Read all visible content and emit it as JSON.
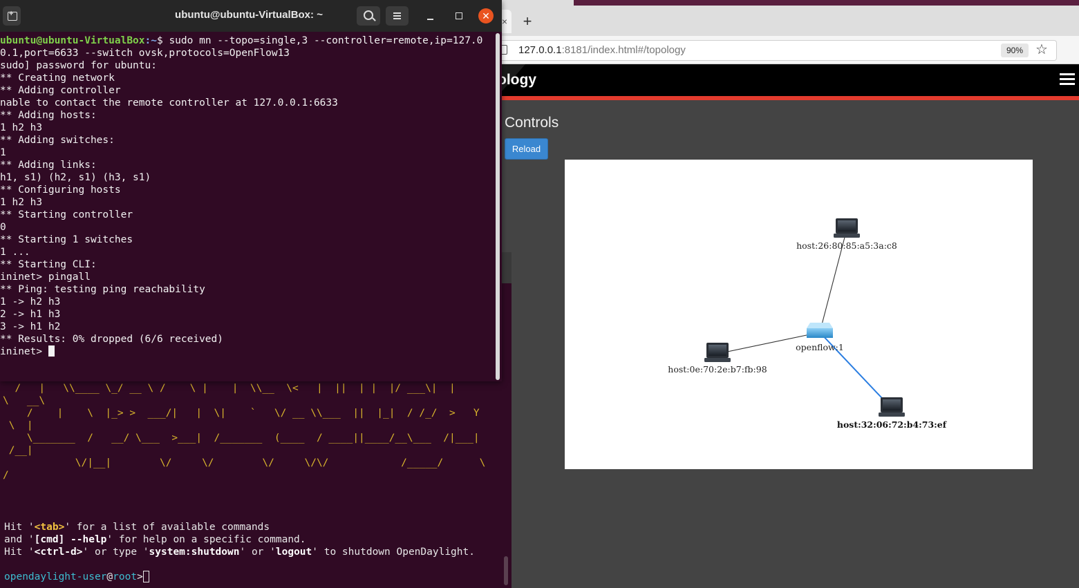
{
  "browser": {
    "url_host": "127.0.0.1",
    "url_rest": ":8181/index.html#/topology",
    "zoom": "90%",
    "tab_close_glyph": "×",
    "new_tab_glyph": "+",
    "page_title": "ology",
    "controls_heading": "Controls",
    "reload_label": "Reload"
  },
  "topology": {
    "nodes": [
      {
        "id": "host-top",
        "label": "host:26:80:85:a5:3a:c8",
        "type": "host",
        "bold": false
      },
      {
        "id": "switch",
        "label": "openflow:1",
        "type": "switch",
        "bold": false
      },
      {
        "id": "host-left",
        "label": "host:0e:70:2e:b7:fb:98",
        "type": "host",
        "bold": false
      },
      {
        "id": "host-bottom",
        "label": "host:32:06:72:b4:73:ef",
        "type": "host",
        "bold": true
      }
    ],
    "links": [
      {
        "from": "switch",
        "to": "host-top",
        "color": "#333333"
      },
      {
        "from": "switch",
        "to": "host-left",
        "color": "#333333"
      },
      {
        "from": "switch",
        "to": "host-bottom",
        "color": "#2a7de1"
      }
    ]
  },
  "mininet_terminal": {
    "title": "ubuntu@ubuntu-VirtualBox: ~",
    "prompt_user": "ubuntu@ubuntu-VirtualBox",
    "prompt_path": ":~",
    "command": "$ sudo mn --topo=single,3 --controller=remote,ip=127.0\n0.1,port=6633 --switch ovsk,protocols=OpenFlow13",
    "output": "sudo] password for ubuntu:\n** Creating network\n** Adding controller\nnable to contact the remote controller at 127.0.0.1:6633\n** Adding hosts:\n1 h2 h3\n** Adding switches:\n1\n** Adding links:\nh1, s1) (h2, s1) (h3, s1)\n** Configuring hosts\n1 h2 h3\n** Starting controller\n0\n** Starting 1 switches\n1 ...\n** Starting CLI:\nininet> pingall\n** Ping: testing ping reachability\n1 -> h2 h3\n2 -> h1 h3\n3 -> h1 h2\n** Results: 0% dropped (6/6 received)\nininet> "
  },
  "odl_terminal": {
    "ascii_art": "  /   |   \\\\____ \\_/ __ \\ /    \\ |    |  \\\\__  \\<   |  ||  | |  |/ ___\\|  |\n\\   __\\\n    /    |    \\  |_> >  ___/|   |  \\|    `   \\/ __ \\\\___  ||  |_|  / /_/  >   Y\n \\  |\n    \\_______  /   __/ \\___  >___|  /_______  (____  / ____||____/__\\___  /|___|\n /__|\n            \\/|__|        \\/     \\/        \\/     \\/\\/            /_____/      \\\n/",
    "hint1_pre": "Hit '",
    "hint1_key": "<tab>",
    "hint1_post": "' for a list of available commands",
    "hint2_pre": "and '",
    "hint2_key": "[cmd] --help",
    "hint2_post": "' for help on a specific command.",
    "hint3_pre": "Hit '",
    "hint3_key": "<ctrl-d>",
    "hint3_mid1": "' or type '",
    "hint3_key2": "system:shutdown",
    "hint3_mid2": "' or '",
    "hint3_key3": "logout",
    "hint3_post": "' to shutdown OpenDaylight.",
    "prompt_user": "opendaylight-user",
    "prompt_at": "@",
    "prompt_host": "root",
    "prompt_sym": ">"
  }
}
